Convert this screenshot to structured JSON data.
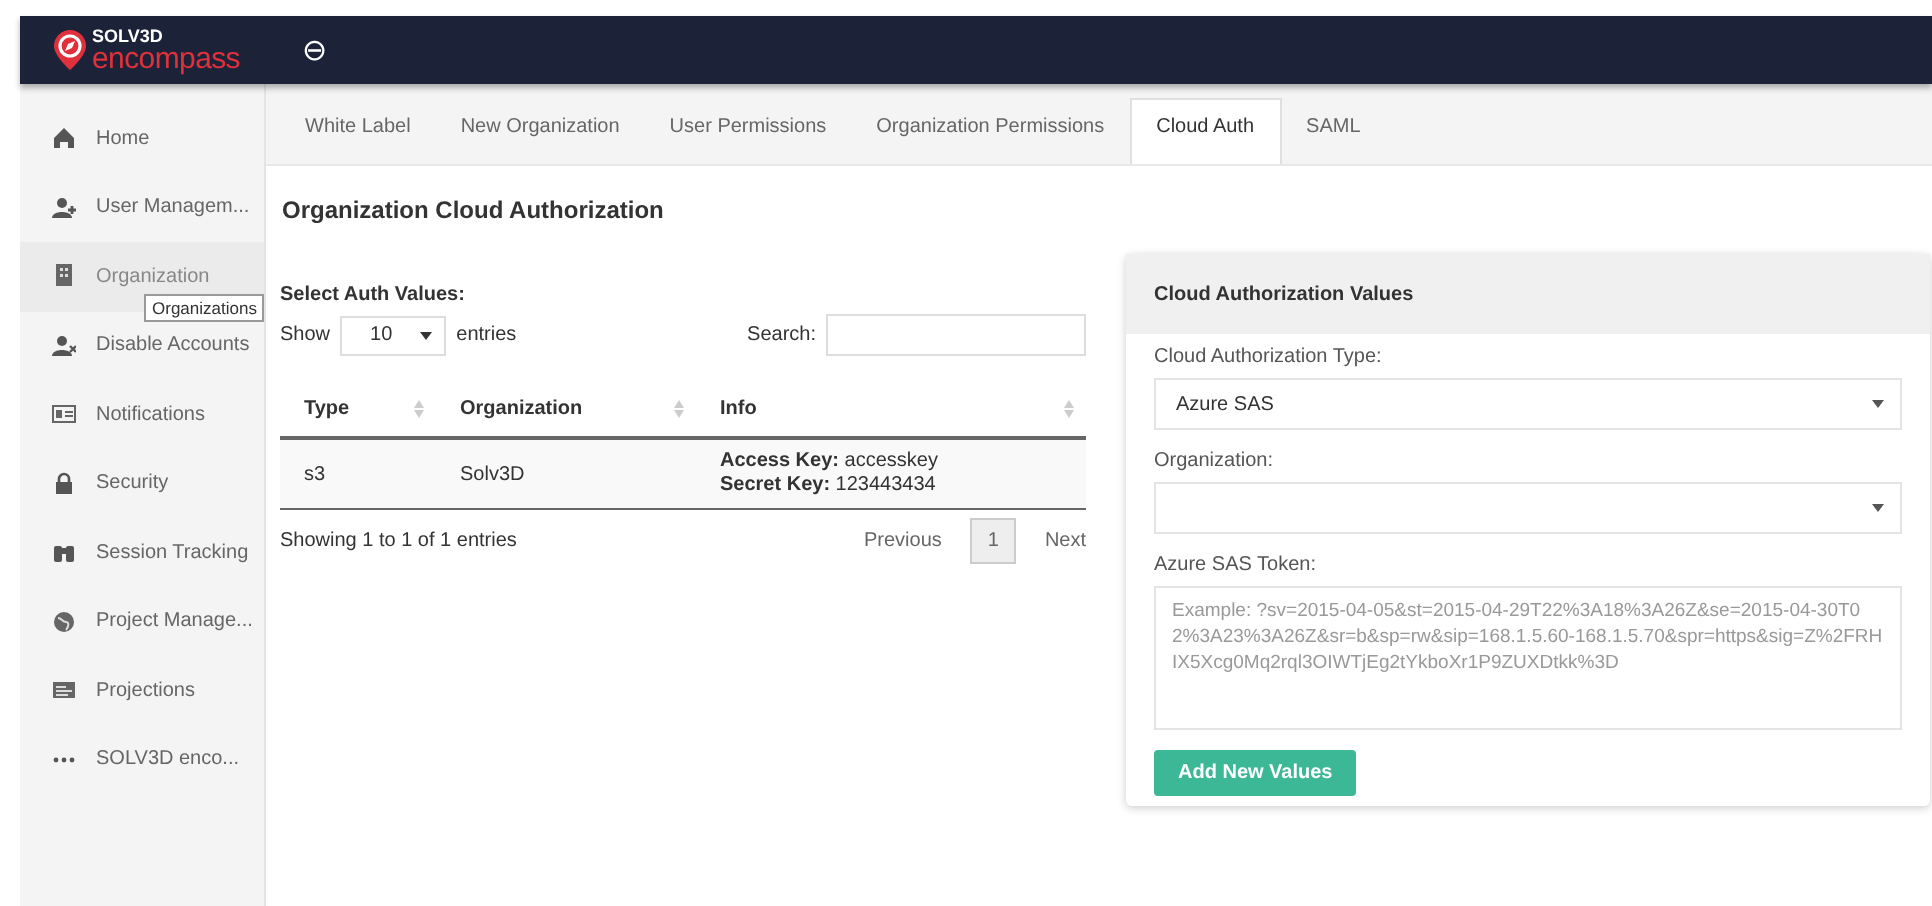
{
  "header": {
    "logo_top": "SOLV3D",
    "logo_bottom": "encompass",
    "back_button": "⊖"
  },
  "sidebar": {
    "items": [
      {
        "label": "Home",
        "selected": false
      },
      {
        "label": "User Managem...",
        "selected": false
      },
      {
        "label": "Organization",
        "selected": true
      },
      {
        "label": "Disable Accounts",
        "selected": false
      },
      {
        "label": "Notifications",
        "selected": false
      },
      {
        "label": "Security",
        "selected": false
      },
      {
        "label": "Session Tracking",
        "selected": false
      },
      {
        "label": "Project Manage...",
        "selected": false
      },
      {
        "label": "Projections",
        "selected": false
      },
      {
        "label": "SOLV3D enco...",
        "selected": false
      }
    ],
    "tooltip": "Organizations"
  },
  "tabs": [
    {
      "label": "White Label",
      "selected": false
    },
    {
      "label": "New Organization",
      "selected": false
    },
    {
      "label": "User Permissions",
      "selected": false
    },
    {
      "label": "Organization Permissions",
      "selected": false
    },
    {
      "label": "Cloud Auth",
      "selected": true
    },
    {
      "label": "SAML",
      "selected": false
    }
  ],
  "page_title": "Organization Cloud Authorization",
  "table_section": {
    "title": "Select Auth Values:",
    "show_label": "Show",
    "page_size": "10",
    "entries_label": "entries",
    "search_label": "Search:",
    "columns": [
      "Type",
      "Organization",
      "Info"
    ],
    "rows": [
      {
        "type": "s3",
        "organization": "Solv3D",
        "info": [
          "**Access Key:** accesskey",
          "**Secret Key:** 123443434"
        ]
      }
    ],
    "summary": "Showing 1 to 1 of 1 entries",
    "pagination": {
      "previous": "Previous",
      "pages": [
        {
          "label": "1",
          "selected": true
        }
      ],
      "next": "Next"
    }
  },
  "panel": {
    "title": "Cloud Authorization Values",
    "type_label": "Cloud Authorization Type:",
    "type_value": "Azure SAS",
    "org_label": "Organization:",
    "token_label": "Azure SAS Token:",
    "token_placeholder": "Example: ?sv=2015-04-05&st=2015-04-29T22%3A18%3A26Z&se=2015-04-30T02%3A23%3A26Z&sr=b&sp=rw&sip=168.1.5.60-168.1.5.70&spr=https&sig=Z%2FRHIX5Xcg0Mq2rql3OIWTjEg2tYkboXr1P9ZUXDtkk%3D",
    "submit": "Add New Values"
  }
}
